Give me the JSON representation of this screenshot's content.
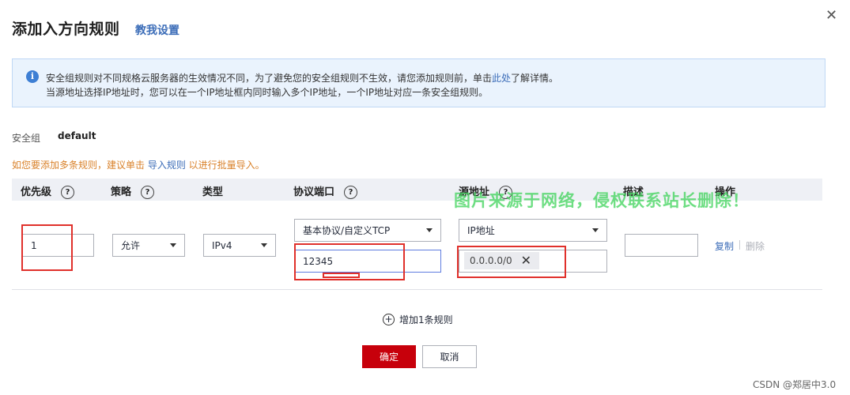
{
  "dialog": {
    "title": "添加入方向规则",
    "help_link": "教我设置",
    "close_glyph": "✕"
  },
  "info": {
    "icon": "info-icon",
    "line1_before": "安全组规则对不同规格云服务器的生效情况不同，为了避免您的安全组规则不生效，请您添加规则前，单击",
    "line1_link": "此处",
    "line1_after": "了解详情。",
    "line2": "当源地址选择IP地址时，您可以在一个IP地址框内同时输入多个IP地址，一个IP地址对应一条安全组规则。"
  },
  "security_group": {
    "label": "安全组",
    "value": "default"
  },
  "hint": {
    "before": "如您要添加多条规则，建议单击 ",
    "link": "导入规则",
    "after": " 以进行批量导入。"
  },
  "table": {
    "headers": {
      "priority": "优先级",
      "policy": "策略",
      "type": "类型",
      "protocol_port": "协议端口",
      "source": "源地址",
      "description": "描述",
      "action": "操作"
    },
    "help_glyph": "?",
    "row": {
      "priority": "1",
      "policy": "允许",
      "type": "IPv4",
      "protocol": "基本协议/自定义TCP",
      "port": "12345",
      "source_type": "IP地址",
      "source_ip": "0.0.0.0/0",
      "description": "",
      "copy": "复制",
      "delete": "删除"
    }
  },
  "add_rule": {
    "label": "增加1条规则",
    "glyph": "+"
  },
  "buttons": {
    "ok": "确定",
    "cancel": "取消"
  },
  "watermark": "图片来源于网络，侵权联系站长删除！",
  "footer_credit": "CSDN @郑居中3.0",
  "colors": {
    "primary_red": "#c7000b",
    "link_blue": "#3c6db8",
    "hint_orange": "#d9822b",
    "annotation_red": "#e0302b",
    "watermark_green": "#3ed35a"
  }
}
